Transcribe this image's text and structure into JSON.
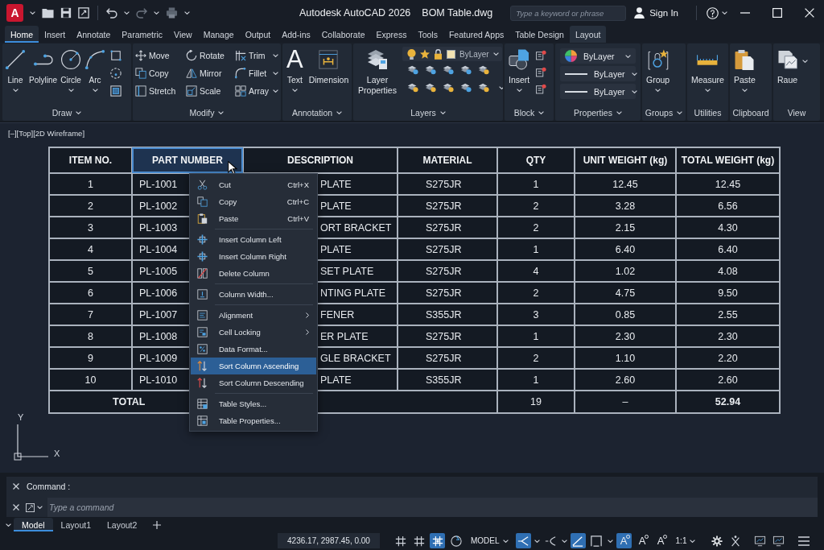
{
  "title_bar": {
    "logo": "A",
    "app_title": "Autodesk AutoCAD 2026",
    "document_title": "BOM Table.dwg",
    "search": {
      "placeholder": "Type a keyword or phrase"
    },
    "sign_in": "Sign In"
  },
  "ribbon_tabs": [
    {
      "label": "Home",
      "selected": true,
      "contextual": false
    },
    {
      "label": "Insert",
      "selected": false,
      "contextual": false
    },
    {
      "label": "Annotate",
      "selected": false,
      "contextual": false
    },
    {
      "label": "Parametric",
      "selected": false,
      "contextual": false
    },
    {
      "label": "View",
      "selected": false,
      "contextual": false
    },
    {
      "label": "Manage",
      "selected": false,
      "contextual": false
    },
    {
      "label": "Output",
      "selected": false,
      "contextual": false
    },
    {
      "label": "Add-ins",
      "selected": false,
      "contextual": false
    },
    {
      "label": "Collaborate",
      "selected": false,
      "contextual": false
    },
    {
      "label": "Express",
      "selected": false,
      "contextual": false
    },
    {
      "label": "Tools",
      "selected": false,
      "contextual": false
    },
    {
      "label": "Featured Apps",
      "selected": false,
      "contextual": false
    },
    {
      "label": "Table Design",
      "selected": false,
      "contextual": false
    },
    {
      "label": "Layout",
      "selected": false,
      "contextual": true
    }
  ],
  "ribbon": {
    "draw": {
      "title": "Draw",
      "expandable": true,
      "tools": [
        {
          "label": "Line",
          "dropdown": true
        },
        {
          "label": "Polyline",
          "dropdown": false
        },
        {
          "label": "Circle",
          "dropdown": true
        },
        {
          "label": "Arc",
          "dropdown": true
        }
      ]
    },
    "modify": {
      "title": "Modify",
      "expandable": true,
      "tools": [
        {
          "label": "Move",
          "dropdown": false
        },
        {
          "label": "Rotate",
          "dropdown": false
        },
        {
          "label": "Trim",
          "dropdown": true
        },
        {
          "label": "Copy",
          "dropdown": false
        },
        {
          "label": "Mirror",
          "dropdown": false
        },
        {
          "label": "Fillet",
          "dropdown": true
        },
        {
          "label": "Stretch",
          "dropdown": false
        },
        {
          "label": "Scale",
          "dropdown": false
        },
        {
          "label": "Array",
          "dropdown": true
        }
      ]
    },
    "annotation": {
      "title": "Annotation",
      "expandable": true,
      "tools": [
        {
          "label": "Text",
          "glyph": "A",
          "dropdown": true
        },
        {
          "label": "Dimension",
          "dropdown": false
        }
      ]
    },
    "layers": {
      "title": "Layers",
      "expandable": true,
      "tools": [
        {
          "label": "Layer Properties",
          "dropdown": false
        }
      ],
      "layer_combo": {
        "value": "ByLayer"
      }
    },
    "block": {
      "title": "Block",
      "expandable": true,
      "tools": [
        {
          "label": "Insert",
          "dropdown": true
        }
      ]
    },
    "properties": {
      "title": "Properties",
      "expandable": true,
      "combos": [
        {
          "kind": "color",
          "value": "ByLayer"
        },
        {
          "kind": "linetype",
          "value": "ByLayer"
        },
        {
          "kind": "lineweight",
          "value": "ByLayer"
        }
      ]
    },
    "groups": {
      "title": "Groups",
      "expandable": true,
      "tools": [
        {
          "label": "Group",
          "dropdown": true
        }
      ]
    },
    "utilities": {
      "title": "Utilities",
      "expandable": false,
      "tools": [
        {
          "label": "Measure",
          "dropdown": true
        }
      ]
    },
    "clipboard": {
      "title": "Clipboard",
      "expandable": false,
      "tools": [
        {
          "label": "Paste",
          "dropdown": true
        }
      ]
    },
    "view": {
      "title": "View",
      "expandable": false,
      "tools": [
        {
          "label": "Raue",
          "dropdown": false
        }
      ]
    }
  },
  "viewport": {
    "label": "[–][Top][2D Wireframe]",
    "table": {
      "columns": [
        {
          "label": "ITEM NO.",
          "selected": false
        },
        {
          "label": "PART NUMBER",
          "selected": true
        },
        {
          "label": "DESCRIPTION",
          "selected": false
        },
        {
          "label": "MATERIAL",
          "selected": false
        },
        {
          "label": "QTY",
          "selected": false
        },
        {
          "label": "UNIT WEIGHT (kg)",
          "selected": false
        },
        {
          "label": "TOTAL WEIGHT (kg)",
          "selected": false
        }
      ],
      "rows": [
        [
          "1",
          "PL-1001",
          "PLATE",
          "S275JR",
          "1",
          "12.45",
          "12.45"
        ],
        [
          "2",
          "PL-1002",
          "PLATE",
          "S275JR",
          "2",
          "3.28",
          "6.56"
        ],
        [
          "3",
          "PL-1003",
          "ORT BRACKET",
          "S275JR",
          "2",
          "2.15",
          "4.30"
        ],
        [
          "4",
          "PL-1004",
          "PLATE",
          "S275JR",
          "1",
          "6.40",
          "6.40"
        ],
        [
          "5",
          "PL-1005",
          "SET PLATE",
          "S275JR",
          "4",
          "1.02",
          "4.08"
        ],
        [
          "6",
          "PL-1006",
          "NTING PLATE",
          "S275JR",
          "2",
          "4.75",
          "9.50"
        ],
        [
          "7",
          "PL-1007",
          "FENER",
          "S355JR",
          "3",
          "0.85",
          "2.55"
        ],
        [
          "8",
          "PL-1008",
          "ER PLATE",
          "S275JR",
          "1",
          "2.30",
          "2.30"
        ],
        [
          "9",
          "PL-1009",
          "GLE BRACKET",
          "S275JR",
          "2",
          "1.10",
          "2.20"
        ],
        [
          "10",
          "PL-1010",
          "PLATE",
          "S355JR",
          "1",
          "2.60",
          "2.60"
        ]
      ],
      "total": {
        "label": "TOTAL",
        "qty": "19",
        "unit_weight": "–",
        "total_weight": "52.94"
      }
    },
    "context_menu": {
      "groups": [
        {
          "items": [
            {
              "label": "Cut",
              "shortcut": "Ctrl+X",
              "submenu": false,
              "selected": false
            },
            {
              "label": "Copy",
              "shortcut": "Ctrl+C",
              "submenu": false,
              "selected": false
            },
            {
              "label": "Paste",
              "shortcut": "Ctrl+V",
              "submenu": false,
              "selected": false
            }
          ]
        },
        {
          "items": [
            {
              "label": "Insert Column Left",
              "submenu": false,
              "selected": false
            },
            {
              "label": "Insert Column Right",
              "submenu": false,
              "selected": false
            },
            {
              "label": "Delete Column",
              "submenu": false,
              "selected": false
            }
          ]
        },
        {
          "items": [
            {
              "label": "Column Width...",
              "submenu": false,
              "selected": false
            }
          ]
        },
        {
          "items": [
            {
              "label": "Alignment",
              "submenu": true,
              "selected": false
            },
            {
              "label": "Cell Locking",
              "submenu": true,
              "selected": false
            },
            {
              "label": "Data Format...",
              "submenu": false,
              "selected": false
            },
            {
              "label": "Sort Column Ascending",
              "submenu": false,
              "selected": true
            },
            {
              "label": "Sort Column Descending",
              "submenu": false,
              "selected": false
            }
          ]
        },
        {
          "items": [
            {
              "label": "Table Styles...",
              "submenu": false,
              "selected": false
            },
            {
              "label": "Table Properties...",
              "submenu": false,
              "selected": false
            }
          ]
        }
      ]
    },
    "ucs": {
      "y_label": "Y",
      "x_label": "X"
    }
  },
  "command_line": {
    "history": "Command :",
    "input": {
      "placeholder": "Type a command"
    }
  },
  "layout_tabs": [
    {
      "label": "Model",
      "selected": true
    },
    {
      "label": "Layout1",
      "selected": false
    },
    {
      "label": "Layout2",
      "selected": false
    }
  ],
  "status_bar": {
    "coordinates": "4236.17, 2987.45, 0.00",
    "drafting_toggles": [
      {
        "on": false
      },
      {
        "on": false
      },
      {
        "on": true
      },
      {
        "on": false
      }
    ],
    "space": "MODEL",
    "snap_toggles": [
      {
        "on": true,
        "dropdown": true
      },
      {
        "on": false,
        "dropdown": true
      },
      {
        "on": true,
        "dropdown": false
      },
      {
        "on": false,
        "dropdown": true
      }
    ],
    "annotation_toggles": [
      {
        "glyph": "A",
        "on": true
      },
      {
        "glyph": "A",
        "on": false
      },
      {
        "glyph": "A",
        "on": false
      }
    ],
    "scale": "1:1"
  }
}
